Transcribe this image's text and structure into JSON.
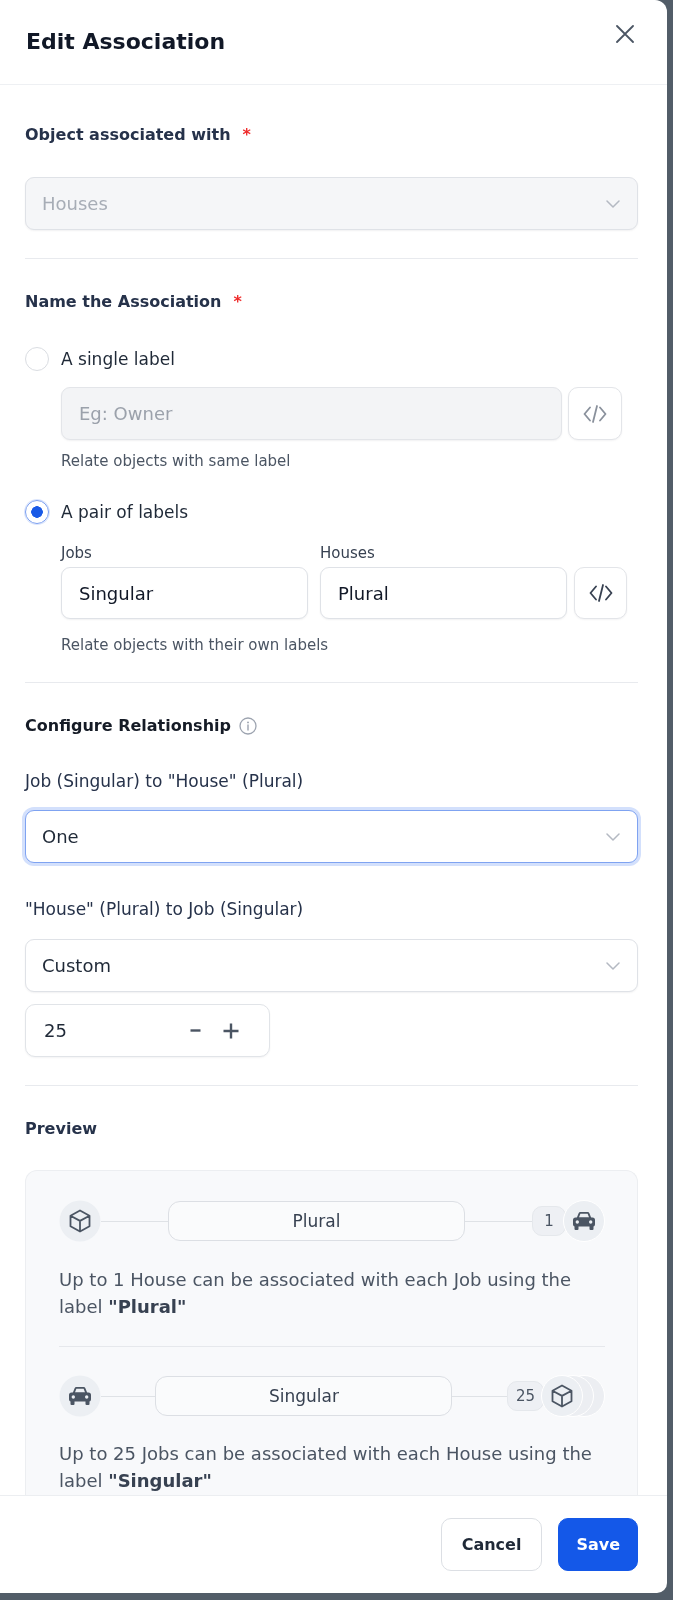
{
  "dialog": {
    "title": "Edit Association"
  },
  "object_field": {
    "label": "Object associated with",
    "required_mark": "*",
    "value": "Houses",
    "disabled": true
  },
  "name_section": {
    "label": "Name the Association",
    "required_mark": "*",
    "options": [
      {
        "kind": "single",
        "label": "A single label",
        "selected": false,
        "input": {
          "placeholder": "Eg: Owner",
          "disabled": true
        },
        "hint": "Relate objects with same label"
      },
      {
        "kind": "pair",
        "label": "A pair of labels",
        "selected": true,
        "fields": [
          {
            "label": "Jobs",
            "value": "Singular"
          },
          {
            "label": "Houses",
            "value": "Plural"
          }
        ],
        "hint": "Relate objects with their own labels"
      }
    ]
  },
  "relationship": {
    "title": "Configure Relationship",
    "rules": [
      {
        "label": "Job (Singular) to \"House\" (Plural)",
        "value": "One",
        "focused": true
      },
      {
        "label": "\"House\" (Plural) to Job (Singular)",
        "value": "Custom",
        "focused": false,
        "count": "25"
      }
    ]
  },
  "preview": {
    "title": "Preview",
    "rows": [
      {
        "label": "Plural",
        "count": "1",
        "stacked": false,
        "text": "Up to 1 House can be associated with each Job using the label **\"Plural\"**"
      },
      {
        "label": "Singular",
        "count": "25",
        "stacked": true,
        "text": "Up to 25 Jobs can be associated with each House using the label **\"Singular\"**"
      }
    ]
  },
  "footer": {
    "buttons": [
      {
        "label": "Cancel",
        "kind": "secondary"
      },
      {
        "label": "Save",
        "kind": "primary"
      }
    ]
  }
}
